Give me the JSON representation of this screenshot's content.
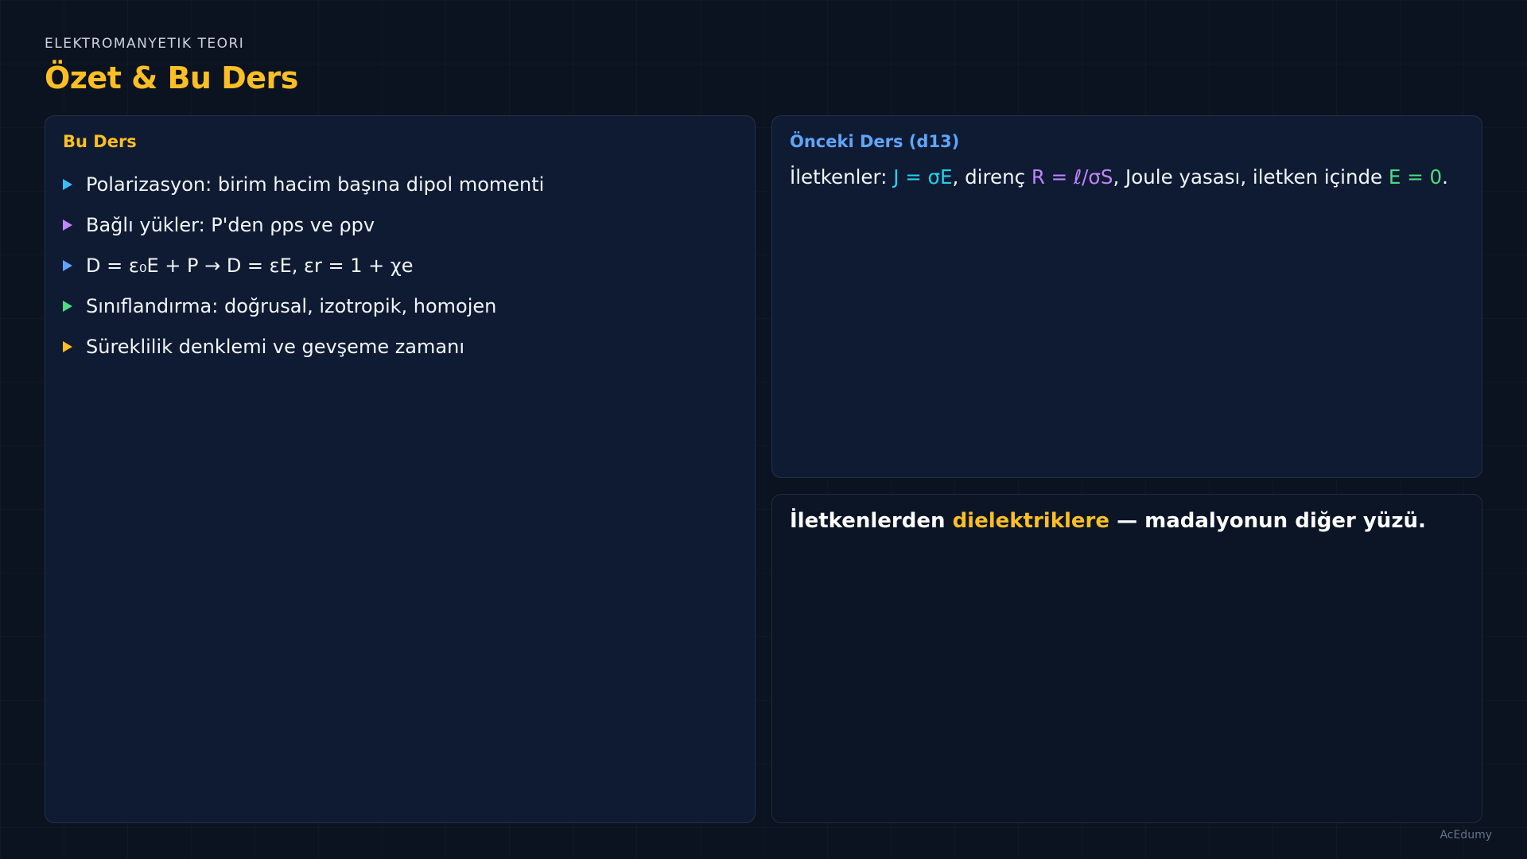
{
  "header": {
    "eyebrow": "ELEKTROMANYETIK TEORI",
    "title": "Özet & Bu Ders"
  },
  "colors": {
    "accent_yellow": "#fbbf24",
    "accent_blue": "#60a5fa",
    "cyan": "#22d3ee",
    "purple": "#c084fc",
    "green": "#4ade80",
    "sky": "#38bdf8"
  },
  "bu_ders": {
    "heading": "Bu Ders",
    "items": [
      {
        "text": "Polarizasyon: birim hacim başına dipol momenti",
        "marker_color": "#38bdf8",
        "icon": "triangle-right-icon"
      },
      {
        "text": "Bağlı yükler: P'den ρps ve ρpv",
        "marker_color": "#c084fc",
        "icon": "triangle-right-icon"
      },
      {
        "text": "D = ε₀E + P → D = εE, εr = 1 + χe",
        "marker_color": "#60a5fa",
        "icon": "triangle-right-icon"
      },
      {
        "text": "Sınıflandırma: doğrusal, izotropik, homojen",
        "marker_color": "#4ade80",
        "icon": "triangle-right-icon"
      },
      {
        "text": "Süreklilik denklemi ve gevşeme zamanı",
        "marker_color": "#fbbf24",
        "icon": "triangle-right-icon"
      }
    ]
  },
  "onceki_ders": {
    "heading": "Önceki Ders (d13)",
    "segments": [
      {
        "text": "İletkenler: ",
        "color": "#f1f5f9"
      },
      {
        "text": "J = σE",
        "color": "#22d3ee"
      },
      {
        "text": ", direnç ",
        "color": "#f1f5f9"
      },
      {
        "text": "R = ℓ/σS",
        "color": "#c084fc"
      },
      {
        "text": ", Joule yasası, iletken içinde ",
        "color": "#f1f5f9"
      },
      {
        "text": "E = 0",
        "color": "#4ade80"
      },
      {
        "text": ".",
        "color": "#f1f5f9"
      }
    ]
  },
  "transition": {
    "segments": [
      {
        "text": "İletkenlerden ",
        "color": "#ffffff"
      },
      {
        "text": "dielektriklere",
        "color": "#fbbf24"
      },
      {
        "text": " — madalyonun diğer yüzü.",
        "color": "#ffffff"
      }
    ]
  },
  "footer": {
    "brand": "AcEdumy"
  }
}
